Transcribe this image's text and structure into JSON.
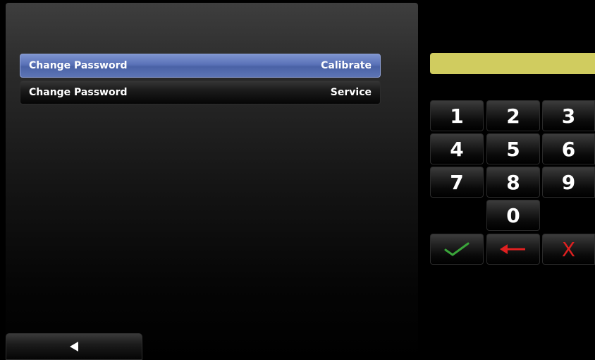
{
  "menu": {
    "items": [
      {
        "label": "Change Password",
        "value": "Calibrate",
        "selected": true
      },
      {
        "label": "Change Password",
        "value": "Service",
        "selected": false
      }
    ]
  },
  "entry": {
    "value": ""
  },
  "keypad": {
    "keys": {
      "k1": "1",
      "k2": "2",
      "k3": "3",
      "k4": "4",
      "k5": "5",
      "k6": "6",
      "k7": "7",
      "k8": "8",
      "k9": "9",
      "k0": "0"
    },
    "enter_icon": "check-icon",
    "backspace_icon": "left-arrow-icon",
    "cancel_label": "X"
  },
  "navigation": {
    "back_icon": "back-arrow-icon"
  },
  "colors": {
    "selected_row": "#5a72b8",
    "entry_display": "#d0cc5f",
    "enter_key": "#3aa63a",
    "cancel_key": "#e02020"
  }
}
